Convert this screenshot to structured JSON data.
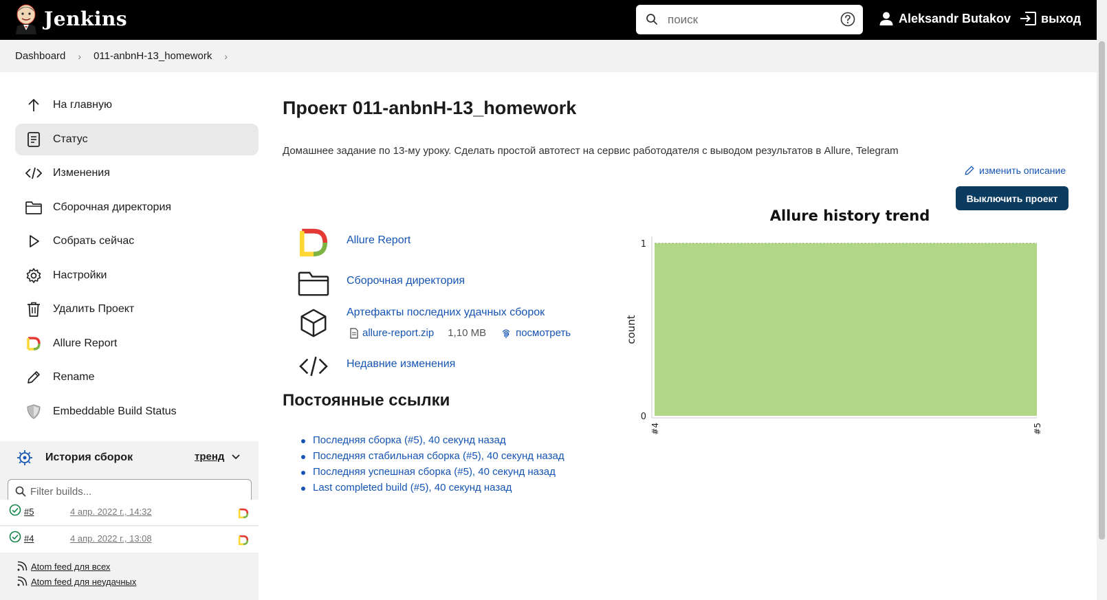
{
  "header": {
    "logo_text": "Jenkins",
    "search_placeholder": "поиск",
    "user_name": "Aleksandr Butakov",
    "logout_label": "выход"
  },
  "breadcrumb": [
    "Dashboard",
    "011-anbnH-13_homework"
  ],
  "sidebar": {
    "items": [
      {
        "label": "На главную",
        "icon": "arrow-up-icon"
      },
      {
        "label": "Статус",
        "icon": "document-icon",
        "active": true
      },
      {
        "label": "Изменения",
        "icon": "code-icon"
      },
      {
        "label": "Сборочная директория",
        "icon": "folder-icon"
      },
      {
        "label": "Собрать сейчас",
        "icon": "play-icon"
      },
      {
        "label": "Настройки",
        "icon": "gear-icon"
      },
      {
        "label": "Удалить Проект",
        "icon": "trash-icon"
      },
      {
        "label": "Allure Report",
        "icon": "allure-icon"
      },
      {
        "label": "Rename",
        "icon": "pencil-icon"
      },
      {
        "label": "Embeddable Build Status",
        "icon": "shield-icon"
      }
    ]
  },
  "build_history": {
    "title": "История сборок",
    "trend_label": "тренд",
    "filter_placeholder": "Filter builds...",
    "builds": [
      {
        "number": "#5",
        "date": "4 апр. 2022 г., 14:32",
        "status": "success"
      },
      {
        "number": "#4",
        "date": "4 апр. 2022 г., 13:08",
        "status": "success"
      }
    ],
    "feeds": [
      "Atom feed для всех",
      "Atom feed для неудачных"
    ]
  },
  "main": {
    "title": "Проект 011-anbnH-13_homework",
    "description": "Домашнее задание по 13-му уроку. Сделать простой автотест на сервис работодателя с выводом результатов в Allure, Telegram",
    "edit_description": "изменить описание",
    "disable_button": "Выключить проект",
    "links": {
      "allure": "Allure Report",
      "workspace": "Сборочная директория",
      "artifacts": "Артефакты последних удачных сборок",
      "artifact_file": "allure-report.zip",
      "artifact_size": "1,10 MB",
      "artifact_view": "посмотреть",
      "changes": "Недавние изменения"
    },
    "permalinks_title": "Постоянные ссылки",
    "permalinks": [
      "Последняя сборка (#5), 40 секунд назад",
      "Последняя стабильная сборка (#5), 40 секунд назад",
      "Последняя успешная сборка (#5), 40 секунд назад",
      "Last completed build (#5), 40 секунд назад"
    ]
  },
  "chart_data": {
    "type": "area",
    "title": "Allure history trend",
    "ylabel": "count",
    "xlabel": "",
    "x": [
      "#4",
      "#5"
    ],
    "series": [
      {
        "values": [
          1,
          1
        ],
        "color": "#b1d685"
      }
    ],
    "ylim": [
      0,
      1
    ],
    "yticks": [
      0,
      1
    ],
    "grid": false
  },
  "colors": {
    "header_bg": "#000000",
    "link": "#1554b3",
    "primary_button": "#0b3b5e",
    "success": "#138347",
    "chart_fill": "#b1d685"
  }
}
